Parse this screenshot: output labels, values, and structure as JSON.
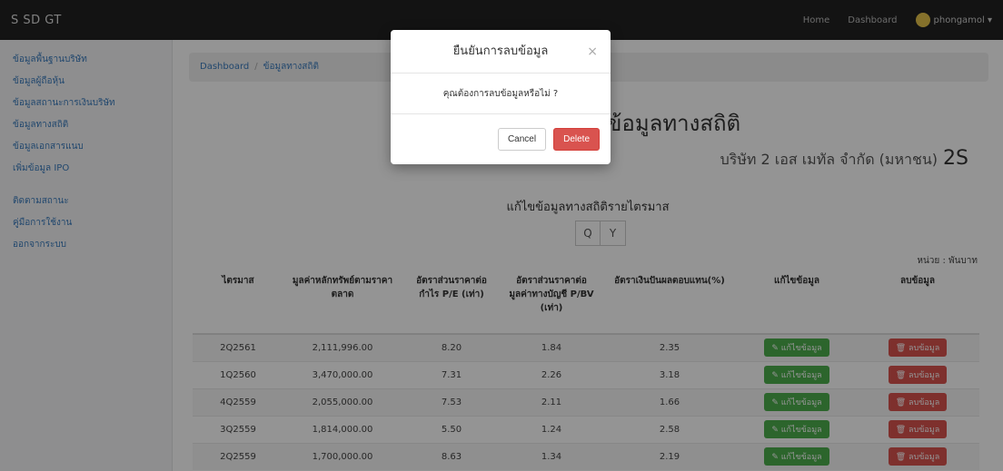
{
  "app": {
    "brand": "S SD GT"
  },
  "topnav": {
    "home": "Home",
    "dashboard": "Dashboard",
    "user": "phongamol ▾"
  },
  "sidebar": {
    "items": [
      "ข้อมูลพื้นฐานบริษัท",
      "ข้อมูลผู้ถือหุ้น",
      "ข้อมูลสถานะการเงินบริษัท",
      "ข้อมูลทางสถิติ",
      "ข้อมูลเอกสารแนบ",
      "เพิ่มข้อมูล IPO"
    ],
    "items2": [
      "ติดตามสถานะ",
      "คู่มือการใช้งาน",
      "ออกจากระบบ"
    ]
  },
  "breadcrumb": {
    "home": "Dashboard",
    "current": "ข้อมูลทางสถิติ"
  },
  "page": {
    "title": "ข้อมูลทางสถิติ",
    "company": "บริษัท 2 เอส เมทัล จำกัด (มหาชน)",
    "ticker": "2S",
    "section_title": "แก้ไขข้อมูลทางสถิติรายไตรมาส",
    "toggle": [
      "Q",
      "Y"
    ],
    "unit": "หน่วย : พันบาท"
  },
  "table": {
    "headers": [
      "ไตรมาส",
      "มูลค่าหลักทรัพย์ตามราคาตลาด",
      "อัตราส่วนราคาต่อกำไร P/E (เท่า)",
      "อัตราส่วนราคาต่อมูลค่าทางบัญชี P/BV (เท่า)",
      "อัตราเงินปันผลตอบแทน(%)",
      "แก้ไขข้อมูล",
      "ลบข้อมูล"
    ],
    "rows": [
      [
        "2Q2561",
        "2,111,996.00",
        "8.20",
        "1.84",
        "2.35"
      ],
      [
        "1Q2560",
        "3,470,000.00",
        "7.31",
        "2.26",
        "3.18"
      ],
      [
        "4Q2559",
        "2,055,000.00",
        "7.53",
        "2.11",
        "1.66"
      ],
      [
        "3Q2559",
        "1,814,000.00",
        "5.50",
        "1.24",
        "2.58"
      ],
      [
        "2Q2559",
        "1,700,000.00",
        "8.63",
        "1.34",
        "2.19"
      ]
    ],
    "edit_label": "✎ แก้ไขข้อมูล",
    "delete_label": "🗑 ลบข้อมูล"
  },
  "modal": {
    "title": "ยืนยันการลบข้อมูล",
    "close": "×",
    "body": "คุณต้องการลบข้อมูลหรือไม่ ?",
    "cancel": "Cancel",
    "delete": "Delete"
  }
}
